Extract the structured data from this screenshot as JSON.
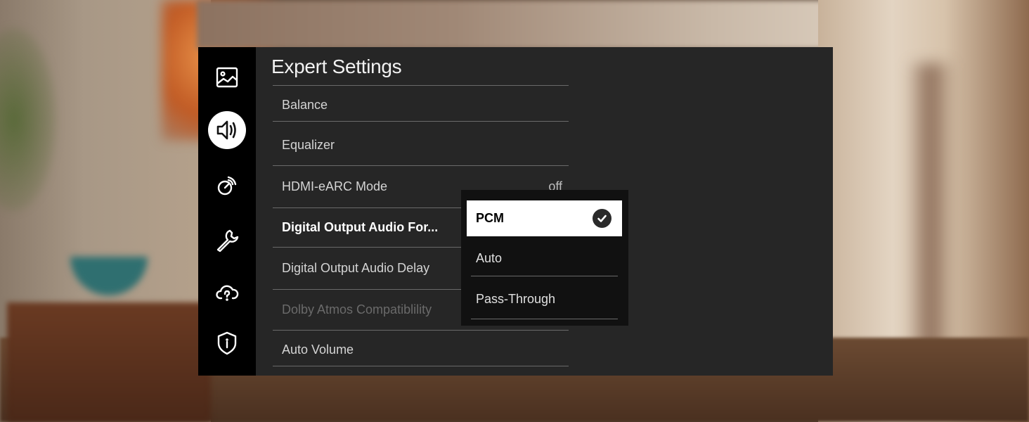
{
  "screen": {
    "title": "Expert Settings"
  },
  "sidebar": {
    "items": [
      {
        "icon": "picture-icon",
        "active": false
      },
      {
        "icon": "speaker-icon",
        "active": true
      },
      {
        "icon": "network-icon",
        "active": false
      },
      {
        "icon": "wrench-icon",
        "active": false
      },
      {
        "icon": "cloud-question-icon",
        "active": false
      },
      {
        "icon": "shield-icon",
        "active": false
      }
    ]
  },
  "menu": {
    "items": [
      {
        "label": "Balance",
        "value": "",
        "state": "normal"
      },
      {
        "label": "Equalizer",
        "value": "",
        "state": "normal"
      },
      {
        "label": "HDMI-eARC Mode",
        "value": "off",
        "state": "normal"
      },
      {
        "label": "Digital Output Audio For...",
        "value": "",
        "state": "focused"
      },
      {
        "label": "Digital Output Audio Delay",
        "value": "",
        "state": "normal"
      },
      {
        "label": "Dolby Atmos Compatiblility",
        "value": "",
        "state": "disabled"
      },
      {
        "label": "Auto Volume",
        "value": "",
        "state": "normal"
      }
    ]
  },
  "dropdown": {
    "options": [
      {
        "label": "PCM",
        "selected": true
      },
      {
        "label": "Auto",
        "selected": false
      },
      {
        "label": "Pass-Through",
        "selected": false
      }
    ]
  },
  "colors": {
    "panel": "#262626",
    "sidebar": "#000000",
    "dropdown": "#111111",
    "selected_bg": "#ffffff",
    "divider": "#6a6a6a"
  }
}
